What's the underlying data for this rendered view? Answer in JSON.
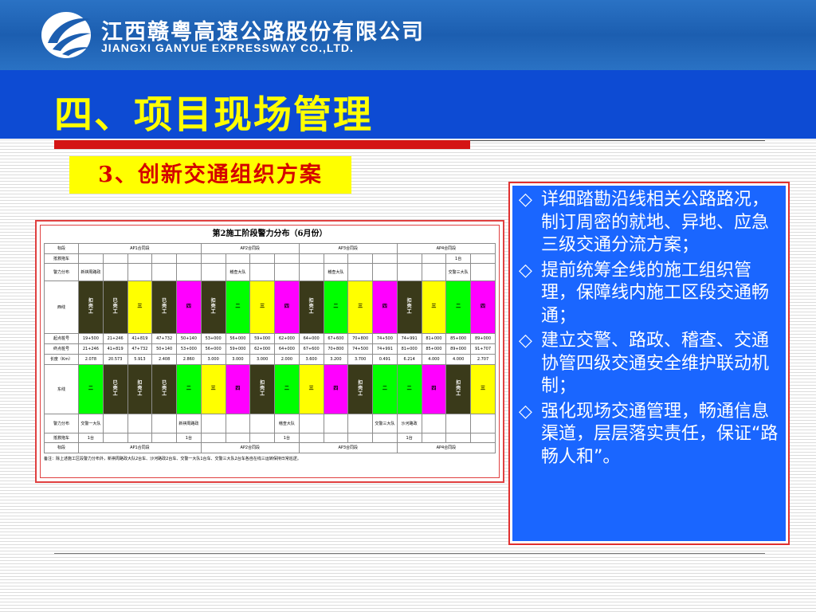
{
  "header": {
    "company_cn": "江西赣粤高速公路股份有限公司",
    "company_en": "JIANGXI GANYUE EXPRESSWAY CO.,LTD.",
    "logo_icon": "ganyue-wing-logo"
  },
  "page": {
    "title": "四、项目现场管理",
    "subtitle": "3、创新交通组织方案",
    "colors": {
      "header_blue": "#1c5eb0",
      "title_bar": "#0d4bd3",
      "title_text": "#ffff00",
      "accent_red": "#d41414",
      "panel_blue": "#1a66ff"
    }
  },
  "table": {
    "title": "第2施工阶段警力分布（6月份）",
    "row_labels": {
      "section": "标段",
      "rescue_top": "抵救拖车",
      "police_top": "警力分布",
      "westbound": "西线",
      "start": "起点桩号",
      "end": "终点桩号",
      "length": "长度（Km）",
      "eastbound": "东线",
      "police_bottom": "警力分布",
      "rescue_bottom": "抵救拖车",
      "section_bottom": "标段"
    },
    "sections": [
      "AP1合同段",
      "AP2合同段",
      "AP3合同段",
      "AP4合同段"
    ],
    "rescue_top_cells": [
      "",
      "",
      "",
      "",
      "",
      "",
      "",
      "",
      "",
      "",
      "",
      "",
      "",
      "",
      "",
      "1台",
      ""
    ],
    "police_top_cells": [
      "新祺周路政",
      "",
      "",
      "",
      "",
      "",
      "稽查大队",
      "",
      "",
      "",
      "稽查大队",
      "",
      "",
      "",
      "",
      "交警三大队",
      ""
    ],
    "west_cells": [
      {
        "label": "扣\n壳\n工",
        "color": "dark"
      },
      {
        "label": "已\n壳\n工",
        "color": "dark"
      },
      {
        "label": "三",
        "color": "yellow"
      },
      {
        "label": "已\n壳\n工",
        "color": "dark"
      },
      {
        "label": "四",
        "color": "magenta"
      },
      {
        "label": "扣\n壳\n工",
        "color": "dark"
      },
      {
        "label": "二",
        "color": "green"
      },
      {
        "label": "三",
        "color": "yellow"
      },
      {
        "label": "四",
        "color": "magenta"
      },
      {
        "label": "扣\n壳\n工",
        "color": "dark"
      },
      {
        "label": "二",
        "color": "green"
      },
      {
        "label": "三",
        "color": "yellow"
      },
      {
        "label": "四",
        "color": "magenta"
      },
      {
        "label": "扣\n壳\n工",
        "color": "dark"
      },
      {
        "label": "三",
        "color": "yellow"
      },
      {
        "label": "二",
        "color": "green"
      },
      {
        "label": "四",
        "color": "magenta"
      }
    ],
    "start_cells": [
      "19+500",
      "21+246",
      "41+819",
      "47+732",
      "50+140",
      "53+000",
      "56+000",
      "59+000",
      "62+000",
      "64+000",
      "67+600",
      "70+800",
      "74+500",
      "74+991",
      "81+000",
      "85+000",
      "89+000"
    ],
    "end_cells": [
      "21+246",
      "41+819",
      "47+732",
      "50+140",
      "53+000",
      "56+000",
      "59+000",
      "62+000",
      "64+000",
      "67+600",
      "70+800",
      "74+500",
      "74+991",
      "81+000",
      "85+000",
      "89+000",
      "91+707"
    ],
    "length_cells": [
      "2.078",
      "20.573",
      "5.913",
      "2.408",
      "2.860",
      "3.000",
      "3.000",
      "3.000",
      "2.000",
      "3.600",
      "3.200",
      "3.700",
      "0.491",
      "6.214",
      "4.000",
      "4.000",
      "2.707"
    ],
    "east_cells": [
      {
        "label": "二",
        "color": "green"
      },
      {
        "label": "已\n壳\n工",
        "color": "dark"
      },
      {
        "label": "扣\n壳\n工",
        "color": "dark"
      },
      {
        "label": "已\n壳\n工",
        "color": "dark"
      },
      {
        "label": "二",
        "color": "green"
      },
      {
        "label": "三",
        "color": "yellow"
      },
      {
        "label": "四",
        "color": "magenta"
      },
      {
        "label": "扣\n壳\n工",
        "color": "dark"
      },
      {
        "label": "二",
        "color": "green"
      },
      {
        "label": "三",
        "color": "yellow"
      },
      {
        "label": "四",
        "color": "magenta"
      },
      {
        "label": "扣\n壳\n工",
        "color": "dark"
      },
      {
        "label": "二",
        "color": "green"
      },
      {
        "label": "二",
        "color": "green"
      },
      {
        "label": "四",
        "color": "magenta"
      },
      {
        "label": "扣\n壳\n工",
        "color": "dark"
      },
      {
        "label": "三",
        "color": "yellow"
      }
    ],
    "police_bottom_cells": [
      "交警一大队",
      "",
      "",
      "",
      "新祺周路政",
      "",
      "",
      "",
      "稽查大队",
      "",
      "",
      "",
      "交警三大队",
      "沙河路政",
      "",
      "",
      ""
    ],
    "rescue_bottom_cells": [
      "1台",
      "",
      "",
      "",
      "1台",
      "",
      "",
      "",
      "1台",
      "",
      "",
      "",
      "",
      "1台",
      "",
      "",
      ""
    ],
    "note": "备注：除上述施工区段警力分布外，新祺周路政大队2台车、沙河路政2台车、交警一大队1台车、交警三大队2台车各自在线三运转保持日常巡逻。"
  },
  "bullets": [
    {
      "marker": "◇",
      "text": "详细踏勘沿线相关公路路况，制订周密的就地、异地、应急三级交通分流方案；"
    },
    {
      "marker": "◇",
      "text": "提前统筹全线的施工组织管理，保障线内施工区段交通畅通；"
    },
    {
      "marker": "◇",
      "text": "建立交警、路政、稽查、交通协管四级交通安全维护联动机制；"
    },
    {
      "marker": "◇",
      "text": "强化现场交通管理，畅通信息渠道，层层落实责任，保证“路畅人和”。"
    }
  ]
}
